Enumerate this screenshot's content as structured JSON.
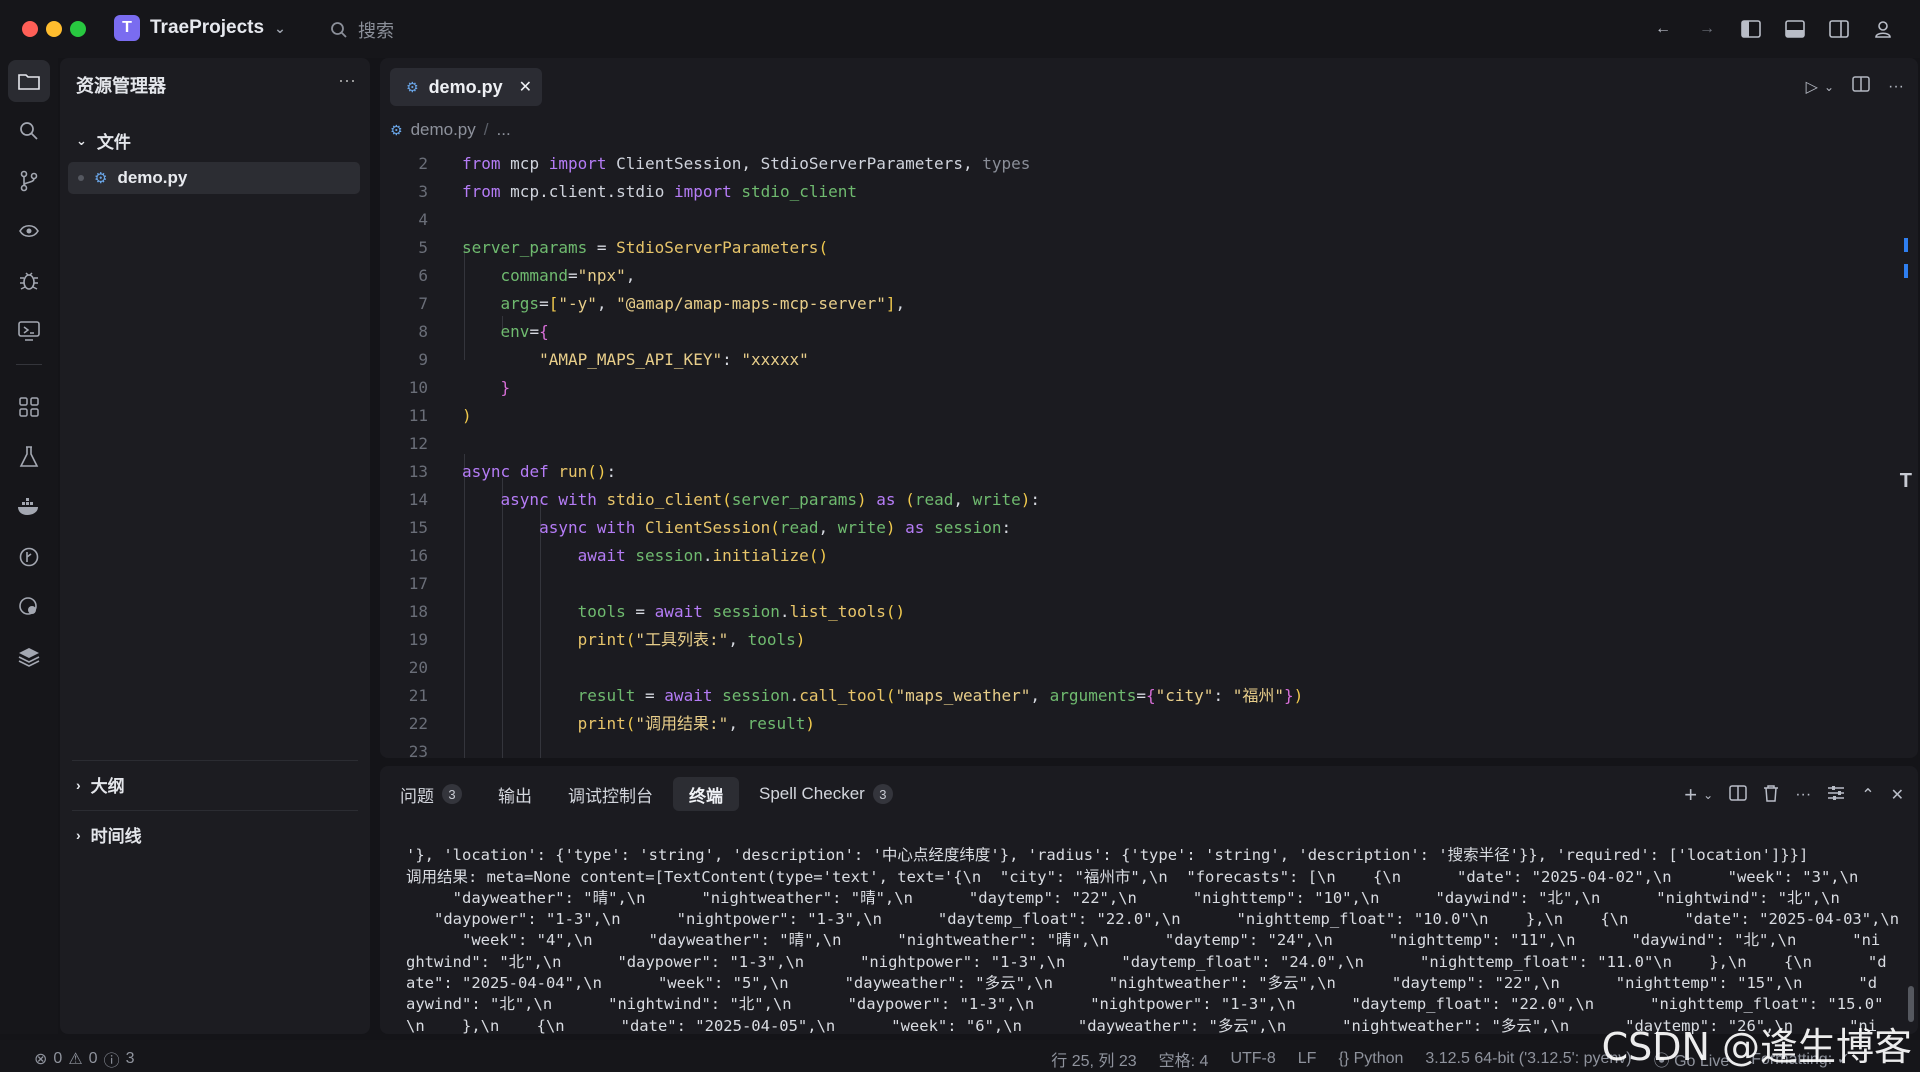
{
  "titlebar": {
    "project_initial": "T",
    "project_name": "TraeProjects",
    "search_placeholder": "搜索"
  },
  "sidebar": {
    "title": "资源管理器",
    "section_files": "文件",
    "file_name": "demo.py",
    "section_outline": "大纲",
    "section_timeline": "时间线"
  },
  "editor": {
    "tab_label": "demo.py",
    "breadcrumb_file": "demo.py",
    "breadcrumb_sep": "/",
    "breadcrumb_more": "...",
    "line_numbers": [
      "2",
      "3",
      "4",
      "5",
      "6",
      "7",
      "8",
      "9",
      "10",
      "11",
      "12",
      "13",
      "14",
      "15",
      "16",
      "17",
      "18",
      "19",
      "20",
      "21",
      "22",
      "23"
    ],
    "lines": [
      "from mcp import ClientSession, StdioServerParameters, types",
      "from mcp.client.stdio import stdio_client",
      "",
      "server_params = StdioServerParameters(",
      "    command=\"npx\",",
      "    args=[\"-y\", \"@amap/amap-maps-mcp-server\"],",
      "    env={",
      "        \"AMAP_MAPS_API_KEY\": \"xxxxx\"",
      "    }",
      ")",
      "",
      "async def run():",
      "    async with stdio_client(server_params) as (read, write):",
      "        async with ClientSession(read, write) as session:",
      "            await session.initialize()",
      "",
      "            tools = await session.list_tools()",
      "            print(\"工具列表:\", tools)",
      "",
      "            result = await session.call_tool(\"maps_weather\", arguments={\"city\": \"福州\"})",
      "            print(\"调用结果:\", result)",
      ""
    ]
  },
  "panel": {
    "tabs": [
      {
        "label": "问题",
        "badge": "3"
      },
      {
        "label": "输出"
      },
      {
        "label": "调试控制台"
      },
      {
        "label": "终端",
        "active": true
      },
      {
        "label": "Spell Checker",
        "badge": "3"
      }
    ],
    "terminal_lines": [
      "'}, 'location': {'type': 'string', 'description': '中心点经度纬度'}, 'radius': {'type': 'string', 'description': '搜索半径'}}, 'required': ['location']}}]",
      "调用结果: meta=None content=[TextContent(type='text', text='{\\n  \"city\": \"福州市\",\\n  \"forecasts\": [\\n    {\\n      \"date\": \"2025-04-02\",\\n      \"week\": \"3\",\\n",
      "     \"dayweather\": \"晴\",\\n      \"nightweather\": \"晴\",\\n      \"daytemp\": \"22\",\\n      \"nighttemp\": \"10\",\\n      \"daywind\": \"北\",\\n      \"nightwind\": \"北\",\\n",
      "   \"daypower\": \"1-3\",\\n      \"nightpower\": \"1-3\",\\n      \"daytemp_float\": \"22.0\",\\n      \"nighttemp_float\": \"10.0\"\\n    },\\n    {\\n      \"date\": \"2025-04-03\",\\n",
      "      \"week\": \"4\",\\n      \"dayweather\": \"晴\",\\n      \"nightweather\": \"晴\",\\n      \"daytemp\": \"24\",\\n      \"nighttemp\": \"11\",\\n      \"daywind\": \"北\",\\n      \"ni",
      "ghtwind\": \"北\",\\n      \"daypower\": \"1-3\",\\n      \"nightpower\": \"1-3\",\\n      \"daytemp_float\": \"24.0\",\\n      \"nighttemp_float\": \"11.0\"\\n    },\\n    {\\n      \"d",
      "ate\": \"2025-04-04\",\\n      \"week\": \"5\",\\n      \"dayweather\": \"多云\",\\n      \"nightweather\": \"多云\",\\n      \"daytemp\": \"22\",\\n      \"nighttemp\": \"15\",\\n      \"d",
      "aywind\": \"北\",\\n      \"nightwind\": \"北\",\\n      \"daypower\": \"1-3\",\\n      \"nightpower\": \"1-3\",\\n      \"daytemp_float\": \"22.0\",\\n      \"nighttemp_float\": \"15.0\"",
      "\\n    },\\n    {\\n      \"date\": \"2025-04-05\",\\n      \"week\": \"6\",\\n      \"dayweather\": \"多云\",\\n      \"nightweather\": \"多云\",\\n      \"daytemp\": \"26\",\\n      \"ni"
    ]
  },
  "status": {
    "errors": "0",
    "warnings": "0",
    "infos": "3",
    "position": "行 25, 列 23",
    "indent": "空格: 4",
    "encoding": "UTF-8",
    "eol": "LF",
    "language": "Python",
    "interpreter": "3.12.5 64-bit ('3.12.5': pyenv)",
    "golive": "Go Live",
    "formatting": "Formatting: ✓"
  },
  "watermark": "CSDN @逢生博客",
  "colors": {
    "accent": "#2f7ff0",
    "traffic_red": "#ff5f57",
    "traffic_yellow": "#febc2e",
    "traffic_green": "#28c840"
  }
}
